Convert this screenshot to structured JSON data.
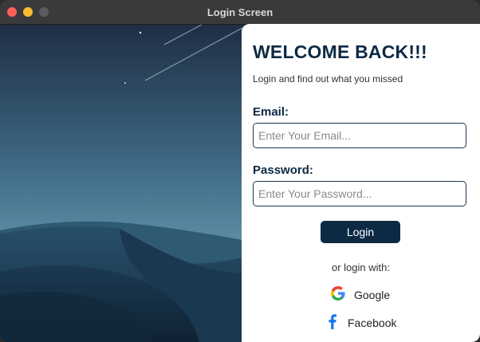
{
  "window": {
    "title": "Login Screen"
  },
  "form": {
    "heading": "WELCOME BACK!!!",
    "subtitle": "Login and find out what you missed",
    "email_label": "Email:",
    "email_placeholder": "Enter Your Email...",
    "password_label": "Password:",
    "password_placeholder": "Enter Your Password...",
    "login_label": "Login",
    "or_text": "or login with:",
    "google_label": "Google",
    "facebook_label": "Facebook"
  },
  "colors": {
    "primary": "#0d2a44",
    "google_blue": "#4285F4",
    "facebook_blue": "#1877F2"
  }
}
